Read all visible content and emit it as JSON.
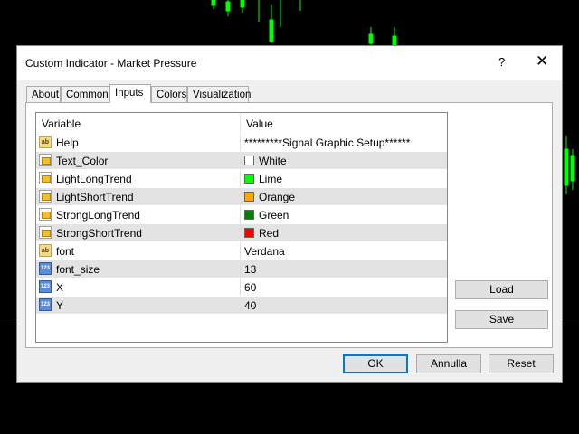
{
  "window": {
    "title": "Custom Indicator - Market Pressure",
    "help": "?",
    "close": "✕"
  },
  "tabs": [
    {
      "label": "About"
    },
    {
      "label": "Common"
    },
    {
      "label": "Inputs"
    },
    {
      "label": "Colors"
    },
    {
      "label": "Visualization"
    }
  ],
  "table": {
    "headers": {
      "variable": "Variable",
      "value": "Value"
    },
    "rows": [
      {
        "type": "ab",
        "name": "Help",
        "value": "*********Signal Graphic Setup******"
      },
      {
        "type": "color",
        "name": "Text_Color",
        "value": "White",
        "color": "#ffffff"
      },
      {
        "type": "color",
        "name": "LightLongTrend",
        "value": "Lime",
        "color": "#00ff00"
      },
      {
        "type": "color",
        "name": "LightShortTrend",
        "value": "Orange",
        "color": "#ffa500"
      },
      {
        "type": "color",
        "name": "StrongLongTrend",
        "value": "Green",
        "color": "#008000"
      },
      {
        "type": "color",
        "name": "StrongShortTrend",
        "value": "Red",
        "color": "#ff0000"
      },
      {
        "type": "ab",
        "name": "font",
        "value": "Verdana"
      },
      {
        "type": "num",
        "name": "font_size",
        "value": "13"
      },
      {
        "type": "num",
        "name": "X",
        "value": "60"
      },
      {
        "type": "num",
        "name": "Y",
        "value": "40"
      }
    ]
  },
  "icons": {
    "ab": "ab",
    "num": "123"
  },
  "buttons": {
    "load": "Load",
    "save": "Save",
    "ok": "OK",
    "cancel": "Annulla",
    "reset": "Reset"
  },
  "colors": {
    "accent": "#0078d7",
    "chart_candle": "#00ff00",
    "background": "#000000"
  }
}
